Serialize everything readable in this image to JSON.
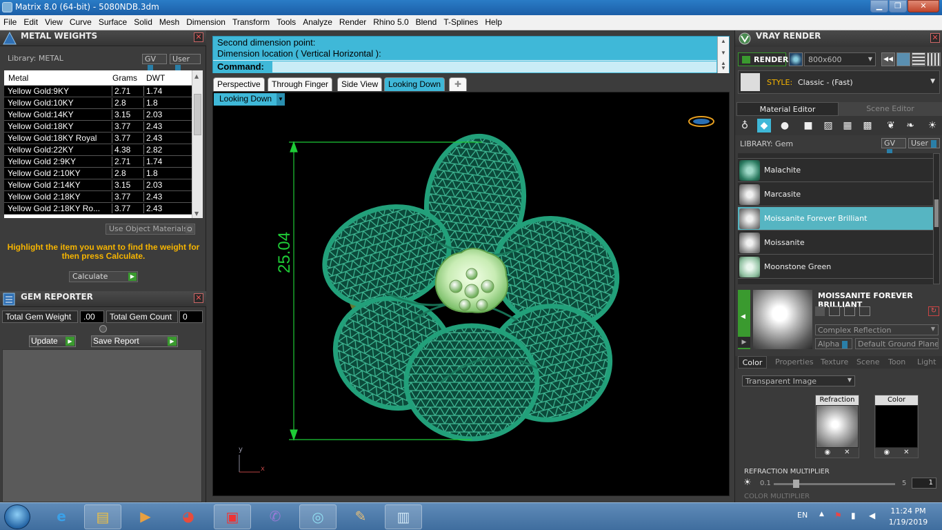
{
  "window": {
    "title": "Matrix 8.0 (64-bit) - 5080NDB.3dm",
    "minimize": "▁",
    "maximize": "❐",
    "close": "✕"
  },
  "menu": [
    "File",
    "Edit",
    "View",
    "Curve",
    "Surface",
    "Solid",
    "Mesh",
    "Dimension",
    "Transform",
    "Tools",
    "Analyze",
    "Render",
    "Rhino 5.0",
    "Blend",
    "T-Splines",
    "Help"
  ],
  "metal_weights": {
    "title": "METAL WEIGHTS",
    "library_label": "Library: METAL",
    "gv_label": "GV",
    "user_label": "User",
    "columns": [
      "Metal",
      "Grams",
      "DWT"
    ],
    "rows": [
      [
        "Yellow Gold:9KY",
        "2.71",
        "1.74"
      ],
      [
        "Yellow Gold:10KY",
        "2.8",
        "1.8"
      ],
      [
        "Yellow Gold:14KY",
        "3.15",
        "2.03"
      ],
      [
        "Yellow Gold:18KY",
        "3.77",
        "2.43"
      ],
      [
        "Yellow Gold:18KY Royal",
        "3.77",
        "2.43"
      ],
      [
        "Yellow Gold:22KY",
        "4.38",
        "2.82"
      ],
      [
        "Yellow Gold 2:9KY",
        "2.71",
        "1.74"
      ],
      [
        "Yellow Gold 2:10KY",
        "2.8",
        "1.8"
      ],
      [
        "Yellow Gold 2:14KY",
        "3.15",
        "2.03"
      ],
      [
        "Yellow Gold 2:18KY",
        "3.77",
        "2.43"
      ],
      [
        "Yellow Gold 2:18KY Ro...",
        "3.77",
        "2.43"
      ]
    ],
    "use_object_materials": "Use Object Materials",
    "hint": "Highlight the item you want to find the weight for then press Calculate.",
    "calculate": "Calculate"
  },
  "gem_reporter": {
    "title": "GEM REPORTER",
    "total_weight_label": "Total Gem Weight",
    "total_weight_value": ".00",
    "total_count_label": "Total Gem Count",
    "total_count_value": "0",
    "update": "Update",
    "save_report": "Save Report"
  },
  "command": {
    "line1": "Second dimension point:",
    "line2": "Dimension location ( Vertical  Horizontal ):",
    "prompt": "Command:"
  },
  "view_tabs": [
    "Perspective",
    "Through Finger",
    "Side View",
    "Looking Down",
    "✚"
  ],
  "active_view_tab": "Looking Down",
  "viewport": {
    "label": "Looking Down",
    "dimension": "25.04",
    "axis_x": "x",
    "axis_y": "y"
  },
  "vray": {
    "title": "VRAY RENDER",
    "render": "RENDER",
    "resolution": "800x600",
    "style_label": "STYLE:",
    "style_value": "Classic - (Fast)",
    "tab_material": "Material Editor",
    "tab_scene": "Scene Editor",
    "library_label": "LIBRARY: Gem",
    "gv_label": "GV",
    "user_label": "User",
    "gems": [
      "Malachite",
      "Marcasite",
      "Moissanite Forever Brilliant",
      "Moissanite",
      "Moonstone Green"
    ],
    "selected_gem": "Moissanite Forever Brilliant",
    "detail_name": "MOISSANITE FOREVER BRILLIANT",
    "reflection": "Complex Reflection",
    "alpha": "Alpha",
    "ground": "Default Ground Plane",
    "prop_tabs": [
      "Color",
      "Properties",
      "Texture",
      "Scene",
      "Toon",
      "Light"
    ],
    "active_prop_tab": "Color",
    "transparent": "Transparent Image",
    "refraction_label": "Refraction",
    "color_label": "Color",
    "refraction_multiplier": "REFRACTION MULTIPLIER",
    "slider_min": "0.1",
    "slider_max": "5",
    "slider_value": "1",
    "color_multiplier": "COLOR MULTIPLIER"
  },
  "taskbar": {
    "language": "EN",
    "time": "11:24 PM",
    "date": "1/19/2019"
  },
  "colors": {
    "accent_cyan": "#3fb8d8",
    "gem_green": "#1e8c6a",
    "dimension_green": "#1ecb36",
    "hint_orange": "#f7b500"
  }
}
